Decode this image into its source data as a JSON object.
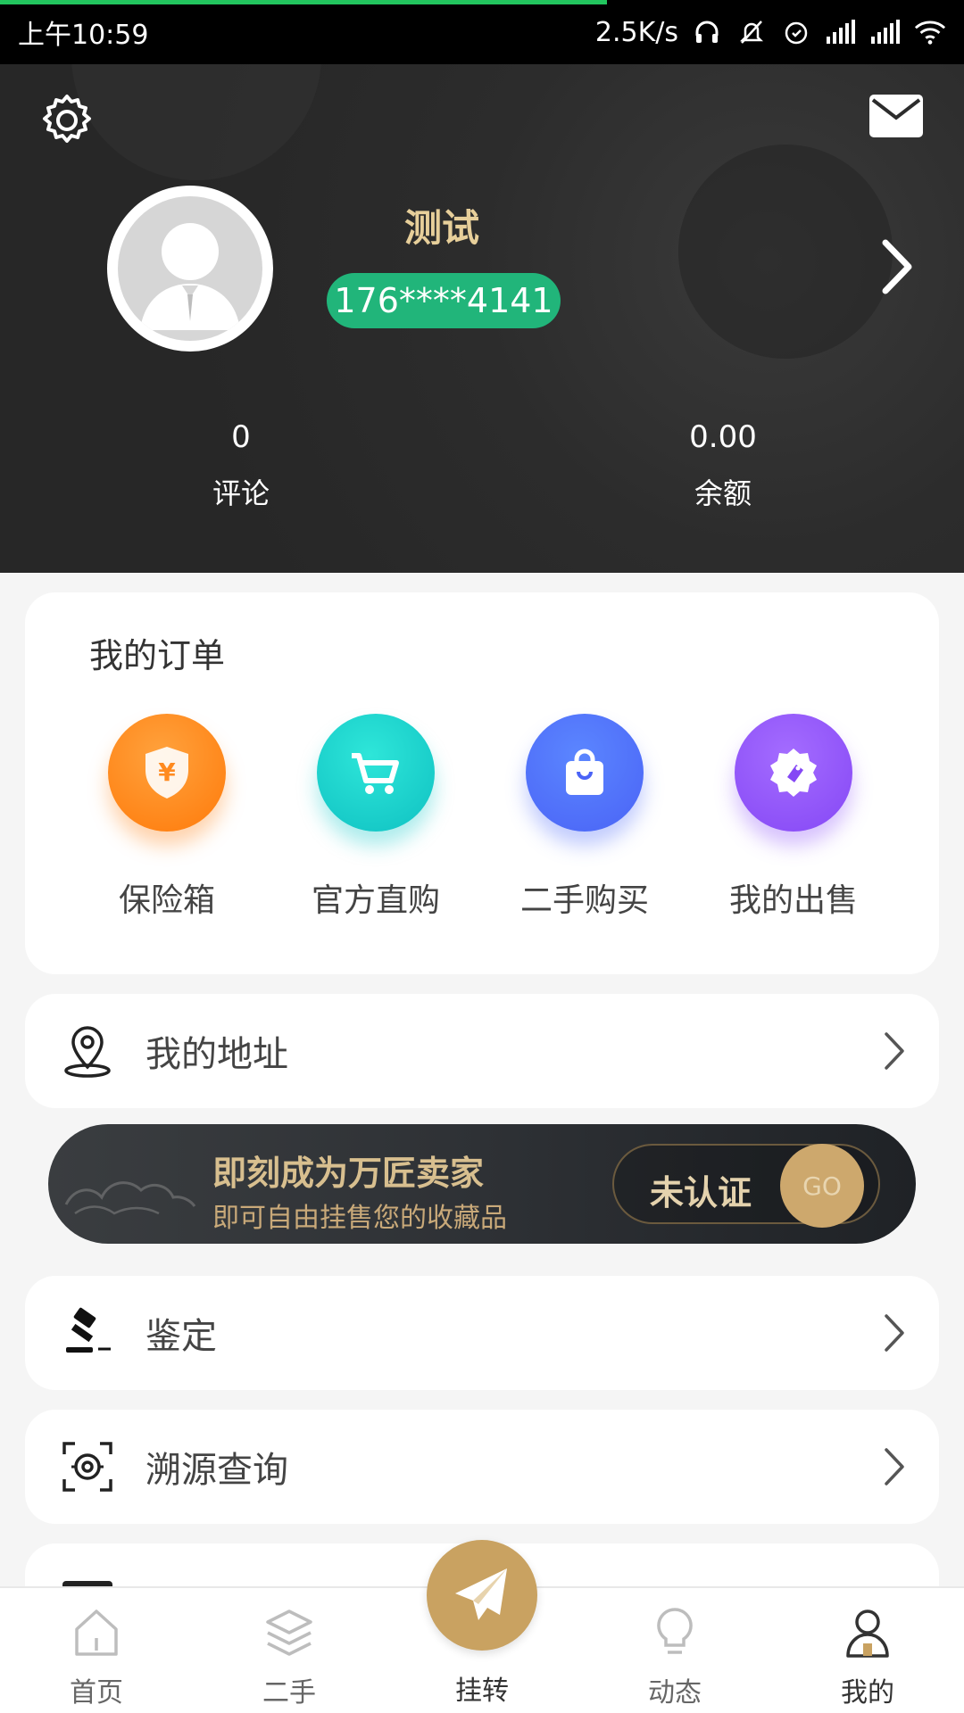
{
  "status_bar": {
    "time": "上午10:59",
    "speed": "2.5K/s"
  },
  "profile": {
    "name": "测试",
    "phone": "176****4141",
    "stats": [
      {
        "value": "0",
        "label": "评论"
      },
      {
        "value": "0.00",
        "label": "余额"
      }
    ]
  },
  "orders": {
    "title": "我的订单",
    "items": [
      {
        "label": "保险箱",
        "icon": "safe-icon"
      },
      {
        "label": "官方直购",
        "icon": "cart-icon"
      },
      {
        "label": "二手购买",
        "icon": "shopping-bag-icon"
      },
      {
        "label": "我的出售",
        "icon": "tag-icon"
      }
    ]
  },
  "menu": {
    "address": "我的地址",
    "appraisal": "鉴定",
    "trace": "溯源查询"
  },
  "seller_banner": {
    "title": "即刻成为万匠卖家",
    "subtitle": "即可自由挂售您的收藏品",
    "status": "未认证",
    "go": "GO"
  },
  "bottom_nav": {
    "home": "首页",
    "secondhand": "二手",
    "transfer": "挂转",
    "feed": "动态",
    "mine": "我的"
  },
  "colors": {
    "accent_gold": "#c9a261",
    "phone_badge": "#21b57a",
    "name_gold": "#e7cf9a"
  }
}
